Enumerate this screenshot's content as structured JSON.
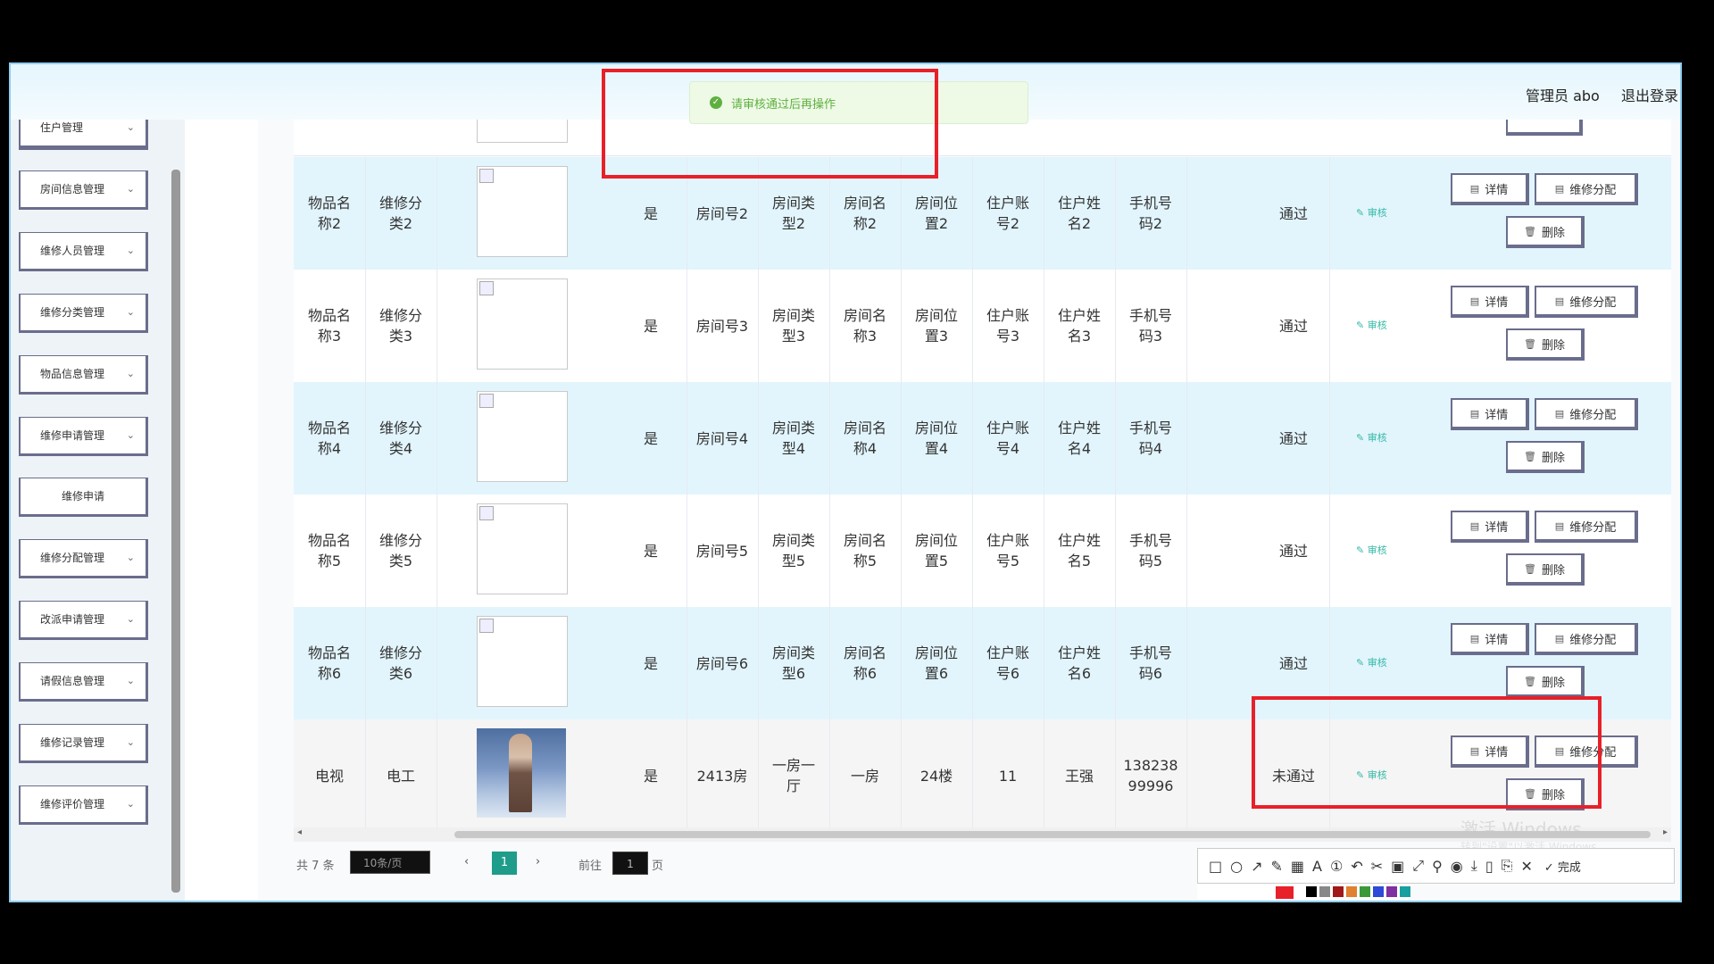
{
  "app": {
    "title": "",
    "admin": "管理员 abo",
    "logout": "退出登录"
  },
  "toast": {
    "message": "请审核通过后再操作",
    "color": "#5fb040"
  },
  "sidebar": {
    "items": [
      {
        "label": "住户管理"
      },
      {
        "label": "房间信息管理"
      },
      {
        "label": "维修人员管理"
      },
      {
        "label": "维修分类管理"
      },
      {
        "label": "物品信息管理"
      },
      {
        "label": "维修申请管理"
      },
      {
        "label": "维修申请"
      },
      {
        "label": "维修分配管理"
      },
      {
        "label": "改派申请管理"
      },
      {
        "label": "请假信息管理"
      },
      {
        "label": "维修记录管理"
      },
      {
        "label": "维修评价管理"
      }
    ]
  },
  "actions": {
    "detail": "详情",
    "assign": "维修分配",
    "delete": "删除",
    "audit": "审核"
  },
  "rows": [
    {
      "item": "物品名\n称2",
      "cat": "维修分\n类2",
      "yes": "是",
      "room_no": "房间号2",
      "room_type": "房间类\n型2",
      "room_name": "房间名\n称2",
      "room_pos": "房间位\n置2",
      "acct": "住户账\n号2",
      "name": "住户姓\n名2",
      "phone": "手机号\n码2",
      "status": "通过"
    },
    {
      "item": "物品名\n称3",
      "cat": "维修分\n类3",
      "yes": "是",
      "room_no": "房间号3",
      "room_type": "房间类\n型3",
      "room_name": "房间名\n称3",
      "room_pos": "房间位\n置3",
      "acct": "住户账\n号3",
      "name": "住户姓\n名3",
      "phone": "手机号\n码3",
      "status": "通过"
    },
    {
      "item": "物品名\n称4",
      "cat": "维修分\n类4",
      "yes": "是",
      "room_no": "房间号4",
      "room_type": "房间类\n型4",
      "room_name": "房间名\n称4",
      "room_pos": "房间位\n置4",
      "acct": "住户账\n号4",
      "name": "住户姓\n名4",
      "phone": "手机号\n码4",
      "status": "通过"
    },
    {
      "item": "物品名\n称5",
      "cat": "维修分\n类5",
      "yes": "是",
      "room_no": "房间号5",
      "room_type": "房间类\n型5",
      "room_name": "房间名\n称5",
      "room_pos": "房间位\n置5",
      "acct": "住户账\n号5",
      "name": "住户姓\n名5",
      "phone": "手机号\n码5",
      "status": "通过"
    },
    {
      "item": "物品名\n称6",
      "cat": "维修分\n类6",
      "yes": "是",
      "room_no": "房间号6",
      "room_type": "房间类\n型6",
      "room_name": "房间名\n称6",
      "room_pos": "房间位\n置6",
      "acct": "住户账\n号6",
      "name": "住户姓\n名6",
      "phone": "手机号\n码6",
      "status": "通过"
    },
    {
      "item": "电视",
      "cat": "电工",
      "yes": "是",
      "room_no": "2413房",
      "room_type": "一房一\n厅",
      "room_name": "一房",
      "room_pos": "24楼",
      "acct": "11",
      "name": "王强",
      "phone": "138238\n99996",
      "status": "未通过"
    }
  ],
  "pagination": {
    "total": "共 7 条",
    "page_size": "10条/页",
    "current": "1",
    "goto_label": "前往",
    "goto_value": "1",
    "page_suffix": "页"
  },
  "watermark": {
    "line1": "激活 Windows",
    "line2": "转到\"设置\"以激活 Windows。"
  },
  "snip_toolbar": {
    "done": "完成"
  },
  "colors": {
    "accent": "#1f9c8a",
    "highlight_row": "#e2f5fd",
    "red_box": "#e8202a"
  }
}
